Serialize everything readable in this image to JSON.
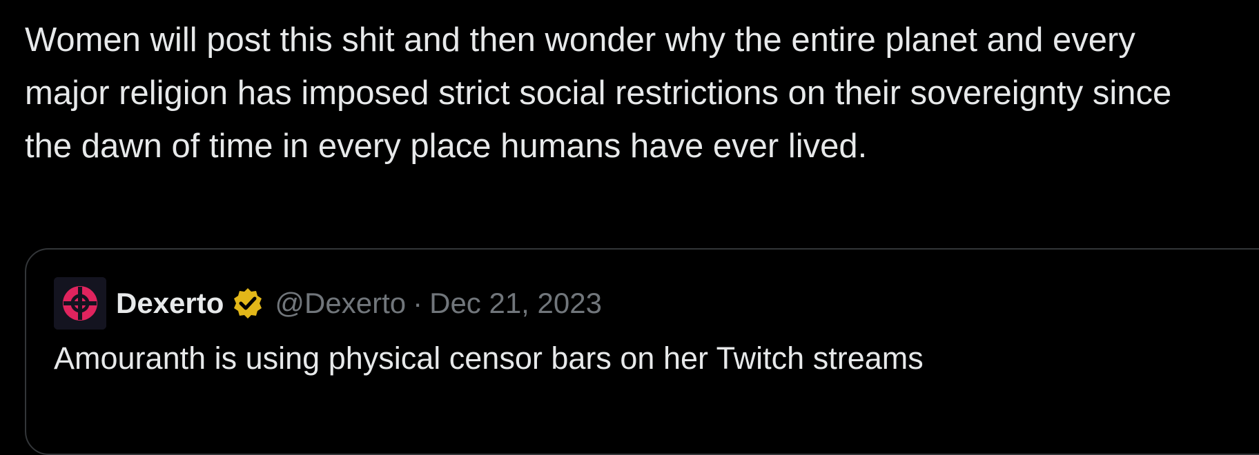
{
  "post": {
    "text": "Women will post this shit and then wonder why the entire planet and every major religion has imposed strict social restrictions on their sovereignty since the dawn of time in every place humans have ever lived."
  },
  "quoted_post": {
    "author_name": "Dexerto",
    "handle": "@Dexerto",
    "separator": "·",
    "date": "Dec 21, 2023",
    "text": "Amouranth is using physical censor bars on her Twitch streams",
    "avatar_icon": "dexerto-logo-icon",
    "verified_icon": "gold-verified-badge-icon"
  },
  "colors": {
    "background": "#000000",
    "text_primary": "#e7e9ea",
    "text_secondary": "#71767b",
    "card_border": "#333639",
    "verified_gold": "#e2b719",
    "avatar_accent": "#e0245e"
  }
}
